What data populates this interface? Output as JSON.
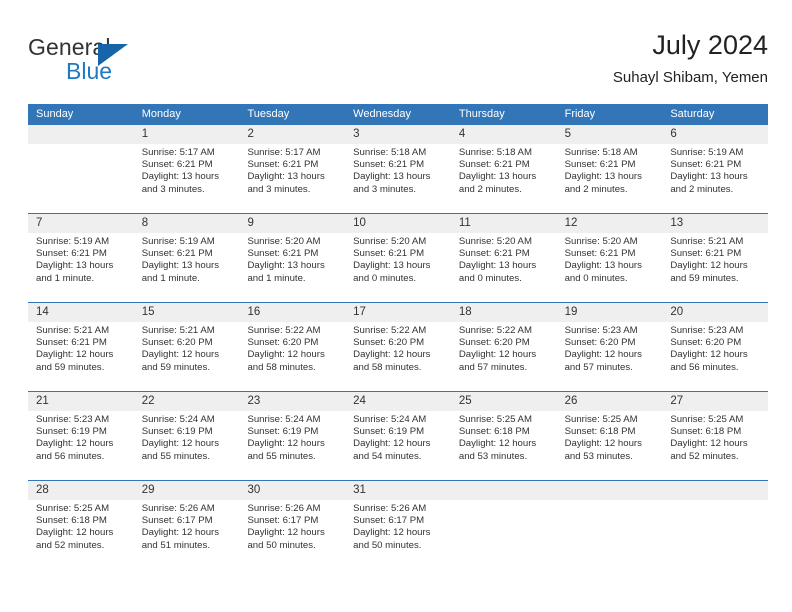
{
  "logo": {
    "word_top": "General",
    "word_bottom": "Blue",
    "triangle_color": "#1565a8",
    "blue_color": "#2079c4",
    "icon": "triangle-icon"
  },
  "header": {
    "title": "July 2024",
    "location": "Suhayl Shibam, Yemen"
  },
  "theme": {
    "header_blue": "#3276b8",
    "row_separator": "#3276b8",
    "day_strip_gray": "#efefef",
    "text": "#333333"
  },
  "calendar": {
    "weekdays": [
      "Sunday",
      "Monday",
      "Tuesday",
      "Wednesday",
      "Thursday",
      "Friday",
      "Saturday"
    ],
    "weeks": [
      [
        {
          "day": "",
          "sunrise": "",
          "sunset": "",
          "daylight": ""
        },
        {
          "day": "1",
          "sunrise": "Sunrise: 5:17 AM",
          "sunset": "Sunset: 6:21 PM",
          "daylight": "Daylight: 13 hours and 3 minutes."
        },
        {
          "day": "2",
          "sunrise": "Sunrise: 5:17 AM",
          "sunset": "Sunset: 6:21 PM",
          "daylight": "Daylight: 13 hours and 3 minutes."
        },
        {
          "day": "3",
          "sunrise": "Sunrise: 5:18 AM",
          "sunset": "Sunset: 6:21 PM",
          "daylight": "Daylight: 13 hours and 3 minutes."
        },
        {
          "day": "4",
          "sunrise": "Sunrise: 5:18 AM",
          "sunset": "Sunset: 6:21 PM",
          "daylight": "Daylight: 13 hours and 2 minutes."
        },
        {
          "day": "5",
          "sunrise": "Sunrise: 5:18 AM",
          "sunset": "Sunset: 6:21 PM",
          "daylight": "Daylight: 13 hours and 2 minutes."
        },
        {
          "day": "6",
          "sunrise": "Sunrise: 5:19 AM",
          "sunset": "Sunset: 6:21 PM",
          "daylight": "Daylight: 13 hours and 2 minutes."
        }
      ],
      [
        {
          "day": "7",
          "sunrise": "Sunrise: 5:19 AM",
          "sunset": "Sunset: 6:21 PM",
          "daylight": "Daylight: 13 hours and 1 minute."
        },
        {
          "day": "8",
          "sunrise": "Sunrise: 5:19 AM",
          "sunset": "Sunset: 6:21 PM",
          "daylight": "Daylight: 13 hours and 1 minute."
        },
        {
          "day": "9",
          "sunrise": "Sunrise: 5:20 AM",
          "sunset": "Sunset: 6:21 PM",
          "daylight": "Daylight: 13 hours and 1 minute."
        },
        {
          "day": "10",
          "sunrise": "Sunrise: 5:20 AM",
          "sunset": "Sunset: 6:21 PM",
          "daylight": "Daylight: 13 hours and 0 minutes."
        },
        {
          "day": "11",
          "sunrise": "Sunrise: 5:20 AM",
          "sunset": "Sunset: 6:21 PM",
          "daylight": "Daylight: 13 hours and 0 minutes."
        },
        {
          "day": "12",
          "sunrise": "Sunrise: 5:20 AM",
          "sunset": "Sunset: 6:21 PM",
          "daylight": "Daylight: 13 hours and 0 minutes."
        },
        {
          "day": "13",
          "sunrise": "Sunrise: 5:21 AM",
          "sunset": "Sunset: 6:21 PM",
          "daylight": "Daylight: 12 hours and 59 minutes."
        }
      ],
      [
        {
          "day": "14",
          "sunrise": "Sunrise: 5:21 AM",
          "sunset": "Sunset: 6:21 PM",
          "daylight": "Daylight: 12 hours and 59 minutes."
        },
        {
          "day": "15",
          "sunrise": "Sunrise: 5:21 AM",
          "sunset": "Sunset: 6:20 PM",
          "daylight": "Daylight: 12 hours and 59 minutes."
        },
        {
          "day": "16",
          "sunrise": "Sunrise: 5:22 AM",
          "sunset": "Sunset: 6:20 PM",
          "daylight": "Daylight: 12 hours and 58 minutes."
        },
        {
          "day": "17",
          "sunrise": "Sunrise: 5:22 AM",
          "sunset": "Sunset: 6:20 PM",
          "daylight": "Daylight: 12 hours and 58 minutes."
        },
        {
          "day": "18",
          "sunrise": "Sunrise: 5:22 AM",
          "sunset": "Sunset: 6:20 PM",
          "daylight": "Daylight: 12 hours and 57 minutes."
        },
        {
          "day": "19",
          "sunrise": "Sunrise: 5:23 AM",
          "sunset": "Sunset: 6:20 PM",
          "daylight": "Daylight: 12 hours and 57 minutes."
        },
        {
          "day": "20",
          "sunrise": "Sunrise: 5:23 AM",
          "sunset": "Sunset: 6:20 PM",
          "daylight": "Daylight: 12 hours and 56 minutes."
        }
      ],
      [
        {
          "day": "21",
          "sunrise": "Sunrise: 5:23 AM",
          "sunset": "Sunset: 6:19 PM",
          "daylight": "Daylight: 12 hours and 56 minutes."
        },
        {
          "day": "22",
          "sunrise": "Sunrise: 5:24 AM",
          "sunset": "Sunset: 6:19 PM",
          "daylight": "Daylight: 12 hours and 55 minutes."
        },
        {
          "day": "23",
          "sunrise": "Sunrise: 5:24 AM",
          "sunset": "Sunset: 6:19 PM",
          "daylight": "Daylight: 12 hours and 55 minutes."
        },
        {
          "day": "24",
          "sunrise": "Sunrise: 5:24 AM",
          "sunset": "Sunset: 6:19 PM",
          "daylight": "Daylight: 12 hours and 54 minutes."
        },
        {
          "day": "25",
          "sunrise": "Sunrise: 5:25 AM",
          "sunset": "Sunset: 6:18 PM",
          "daylight": "Daylight: 12 hours and 53 minutes."
        },
        {
          "day": "26",
          "sunrise": "Sunrise: 5:25 AM",
          "sunset": "Sunset: 6:18 PM",
          "daylight": "Daylight: 12 hours and 53 minutes."
        },
        {
          "day": "27",
          "sunrise": "Sunrise: 5:25 AM",
          "sunset": "Sunset: 6:18 PM",
          "daylight": "Daylight: 12 hours and 52 minutes."
        }
      ],
      [
        {
          "day": "28",
          "sunrise": "Sunrise: 5:25 AM",
          "sunset": "Sunset: 6:18 PM",
          "daylight": "Daylight: 12 hours and 52 minutes."
        },
        {
          "day": "29",
          "sunrise": "Sunrise: 5:26 AM",
          "sunset": "Sunset: 6:17 PM",
          "daylight": "Daylight: 12 hours and 51 minutes."
        },
        {
          "day": "30",
          "sunrise": "Sunrise: 5:26 AM",
          "sunset": "Sunset: 6:17 PM",
          "daylight": "Daylight: 12 hours and 50 minutes."
        },
        {
          "day": "31",
          "sunrise": "Sunrise: 5:26 AM",
          "sunset": "Sunset: 6:17 PM",
          "daylight": "Daylight: 12 hours and 50 minutes."
        },
        {
          "day": "",
          "sunrise": "",
          "sunset": "",
          "daylight": ""
        },
        {
          "day": "",
          "sunrise": "",
          "sunset": "",
          "daylight": ""
        },
        {
          "day": "",
          "sunrise": "",
          "sunset": "",
          "daylight": ""
        }
      ]
    ]
  }
}
